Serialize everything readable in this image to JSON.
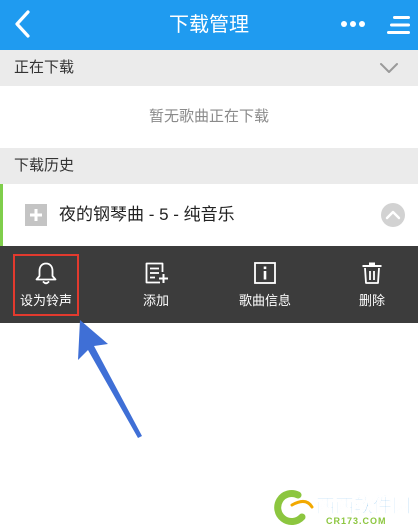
{
  "header": {
    "title": "下载管理",
    "back_icon": "chevron-left-icon",
    "more_icon": "more-dots-icon",
    "menu_icon": "menu-lines-icon"
  },
  "downloading": {
    "label": "正在下载",
    "empty_text": "暂无歌曲正在下载"
  },
  "history": {
    "label": "下载历史",
    "items": [
      {
        "title": "夜的钢琴曲 - 5 - 纯音乐"
      }
    ]
  },
  "actions": [
    {
      "label": "设为铃声",
      "icon": "bell-icon"
    },
    {
      "label": "添加",
      "icon": "add-list-icon"
    },
    {
      "label": "歌曲信息",
      "icon": "info-icon"
    },
    {
      "label": "删除",
      "icon": "trash-icon"
    }
  ],
  "watermark": {
    "brand": "西西软件园",
    "domain": "CR173.COM"
  },
  "colors": {
    "header": "#1f9bf0",
    "section": "#ebebeb",
    "action_bar": "#3c3c3c",
    "row_accent": "#7fce4b",
    "highlight": "#e23a2e",
    "pointer_arrow": "#3f6fd6"
  }
}
